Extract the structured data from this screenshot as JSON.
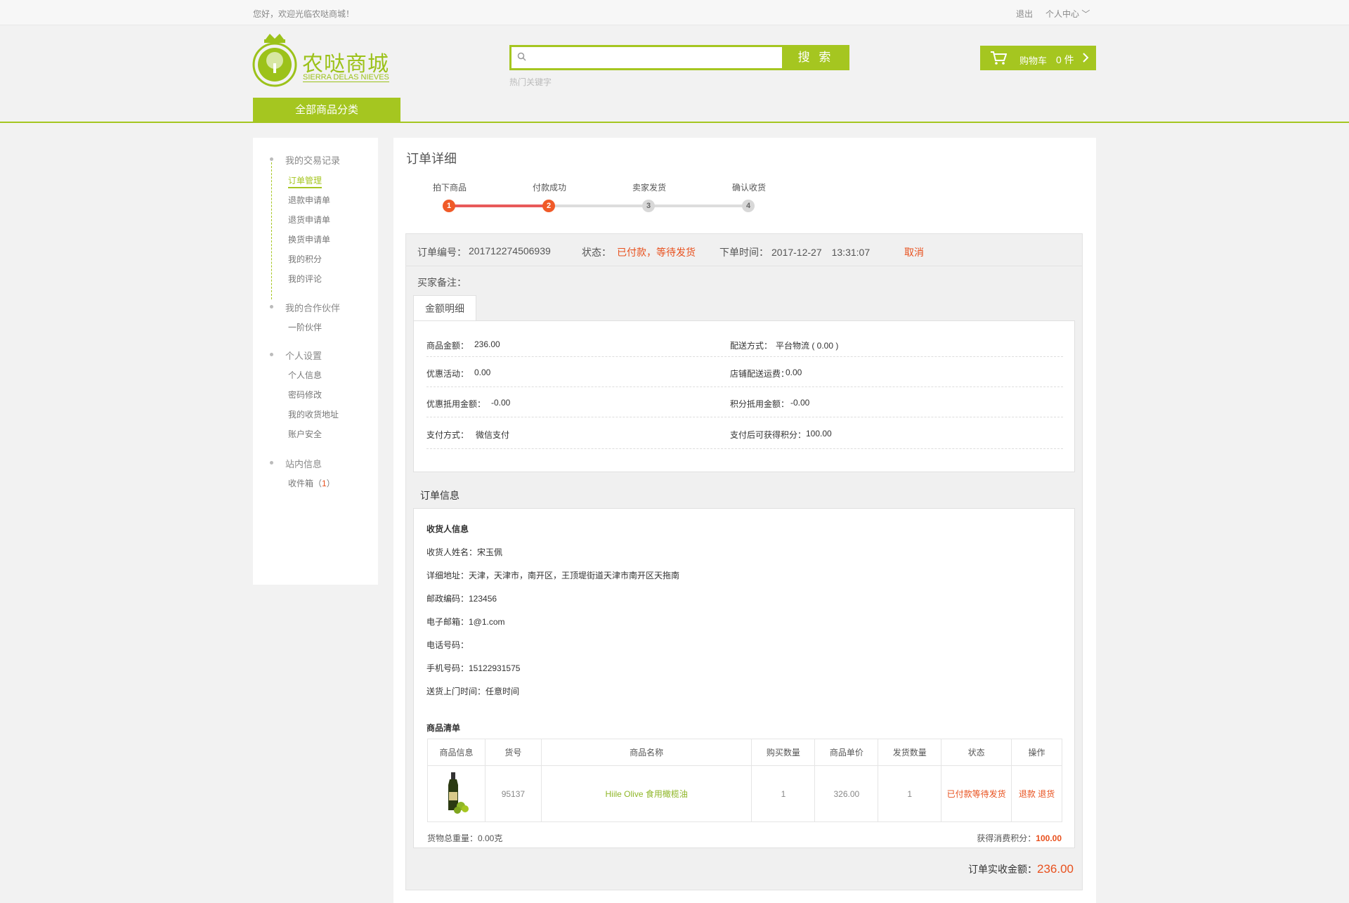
{
  "topbar": {
    "welcome": "您好，欢迎光临农哒商城！",
    "logout": "退出",
    "user_center": "个人中心"
  },
  "logo": {
    "title": "农哒商城",
    "subtitle": "SIERRA DELAS NIEVES"
  },
  "search": {
    "placeholder": "",
    "button": "搜 索",
    "hot_keywords": "热门关键字"
  },
  "cart": {
    "label": "购物车",
    "count": "0 件"
  },
  "category_button": "全部商品分类",
  "sidebar": {
    "groups": [
      {
        "title": "我的交易记录",
        "items": [
          "订单管理",
          "退款申请单",
          "退货申请单",
          "换货申请单",
          "我的积分",
          "我的评论"
        ]
      },
      {
        "title": "我的合作伙伴",
        "items": [
          "一阶伙伴"
        ]
      },
      {
        "title": "个人设置",
        "items": [
          "个人信息",
          "密码修改",
          "我的收货地址",
          "账户安全"
        ]
      },
      {
        "title": "站内信息",
        "items": [
          "收件箱"
        ]
      }
    ],
    "inbox_count": "1"
  },
  "page_title": "订单详细",
  "steps": [
    {
      "label": "拍下商品",
      "num": "1"
    },
    {
      "label": "付款成功",
      "num": "2"
    },
    {
      "label": "卖家发货",
      "num": "3"
    },
    {
      "label": "确认收货",
      "num": "4"
    }
  ],
  "order": {
    "number_label": "订单编号：",
    "number": "201712274506939",
    "status_label": "状态：",
    "status": "已付款，等待发货",
    "time_label": "下单时间：",
    "time": "2017-12-27　13:31:07",
    "cancel": "取消",
    "remark_label": "买家备注："
  },
  "amount_tab": "金额明细",
  "amount": {
    "goods_label": "商品金额：",
    "goods": "236.00",
    "delivery_label": "配送方式：",
    "delivery": "平台物流 ( 0.00 )",
    "promo_label": "优惠活动：",
    "promo": "0.00",
    "shipping_label": "店铺配送运费：",
    "shipping": "0.00",
    "coupon_label": "优惠抵用金额：",
    "coupon": "-0.00",
    "points_deduct_label": "积分抵用金额：",
    "points_deduct": "-0.00",
    "pay_label": "支付方式：",
    "pay": "微信支付",
    "points_earn_label": "支付后可获得积分：",
    "points_earn": "100.00"
  },
  "info_title": "订单信息",
  "receiver": {
    "heading": "收货人信息",
    "name": "收货人姓名：宋玉佩",
    "address": "详细地址：天津，天津市，南开区，王顶堤街道天津市南开区天拖南",
    "zip": "邮政编码：123456",
    "email": "电子邮箱：1@1.com",
    "phone": "电话号码：",
    "mobile": "手机号码：15122931575",
    "delivery_time": "送货上门时间：任意时间"
  },
  "goods_heading": "商品清单",
  "goods_table": {
    "headers": [
      "商品信息",
      "货号",
      "商品名称",
      "购买数量",
      "商品单价",
      "发货数量",
      "状态",
      "操作"
    ],
    "row": {
      "sku": "95137",
      "name": "Hiile Olive 食用橄榄油",
      "qty": "1",
      "price": "326.00",
      "ship_qty": "1",
      "status": "已付款等待发货",
      "refund": "退款",
      "return": "退货"
    }
  },
  "weight": "货物总重量：0.00克",
  "earn_points_label": "获得消费积分：",
  "earn_points": "100.00",
  "total_label": "订单实收金额：",
  "total": "236.00",
  "colors": {
    "accent": "#a5c620",
    "alert": "#e8501d",
    "step_done": "#f05a28"
  }
}
